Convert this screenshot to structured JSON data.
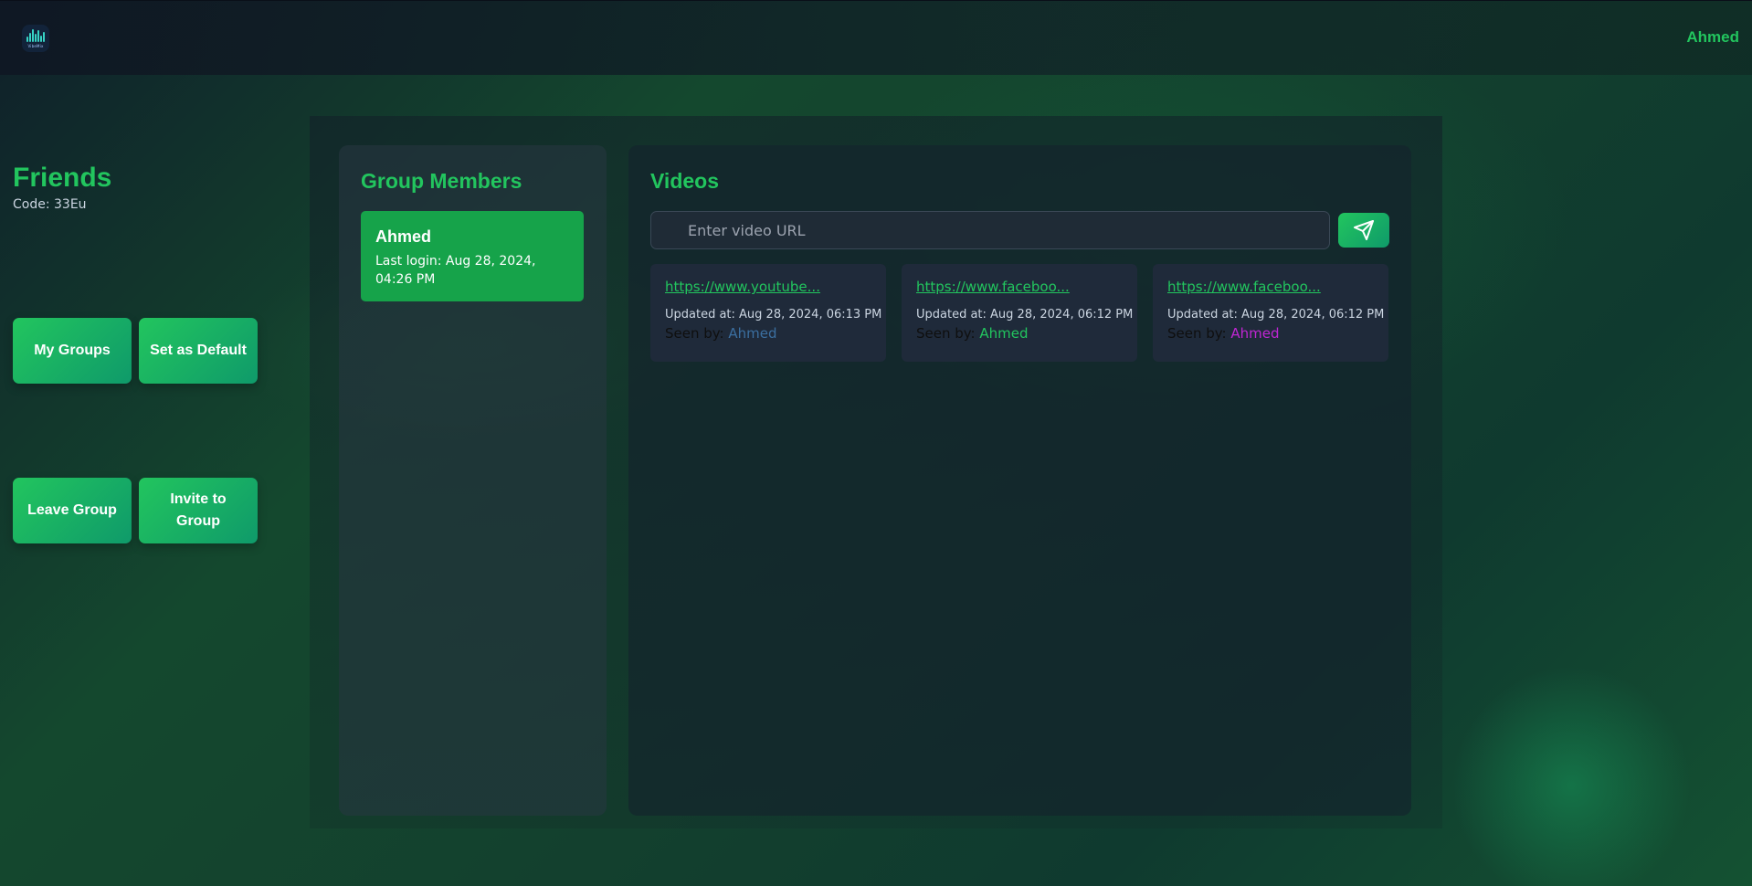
{
  "header": {
    "logo_text": "VibeMix",
    "user_name": "Ahmed"
  },
  "group": {
    "title": "Friends",
    "code": "Code: 33Eu",
    "buttons": {
      "my_groups": "My Groups",
      "set_default": "Set as Default",
      "leave": "Leave Group",
      "invite": "Invite to Group"
    }
  },
  "members": {
    "title": "Group Members",
    "items": [
      {
        "name": "Ahmed",
        "last_login": "Last login: Aug 28, 2024, 04:26 PM"
      }
    ]
  },
  "videos": {
    "title": "Videos",
    "input_placeholder": "Enter video URL",
    "items": [
      {
        "url": "https://www.youtube...",
        "updated": "Updated at: Aug 28, 2024, 06:13 PM",
        "seen_label": "Seen by:",
        "seen_by": "Ahmed",
        "seen_color": "#3b6fa0"
      },
      {
        "url": "https://www.faceboo...",
        "updated": "Updated at: Aug 28, 2024, 06:12 PM",
        "seen_label": "Seen by:",
        "seen_by": "Ahmed",
        "seen_color": "#22c55e"
      },
      {
        "url": "https://www.faceboo...",
        "updated": "Updated at: Aug 28, 2024, 06:12 PM",
        "seen_label": "Seen by:",
        "seen_by": "Ahmed",
        "seen_color": "#c026d3"
      }
    ]
  },
  "colors": {
    "accent": "#22c55e",
    "member_card": "#16a34a"
  },
  "icons": {
    "send": "send-icon",
    "logo": "logo-icon"
  }
}
